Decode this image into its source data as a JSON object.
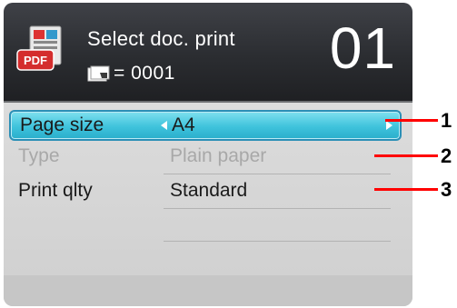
{
  "header": {
    "title": "Select doc. print",
    "doc_count": "= 0001",
    "number": "01",
    "pdf_icon_text": "PDF"
  },
  "menu": {
    "rows": [
      {
        "label": "Page size",
        "value": "A4",
        "state": "selected"
      },
      {
        "label": "Type",
        "value": "Plain paper",
        "state": "disabled"
      },
      {
        "label": "Print qlty",
        "value": "Standard",
        "state": "normal"
      }
    ]
  },
  "callouts": [
    "1",
    "2",
    "3"
  ],
  "colors": {
    "selected_highlight": "#3fc3dc",
    "callout_line": "#ff0000",
    "header_bg": "#2b2d31"
  },
  "icons": {
    "header_left": "pdf-document-icon",
    "doc_count": "page-stack-icon",
    "row_nav_left": "arrow-left-icon",
    "row_nav_right": "arrow-right-icon"
  }
}
